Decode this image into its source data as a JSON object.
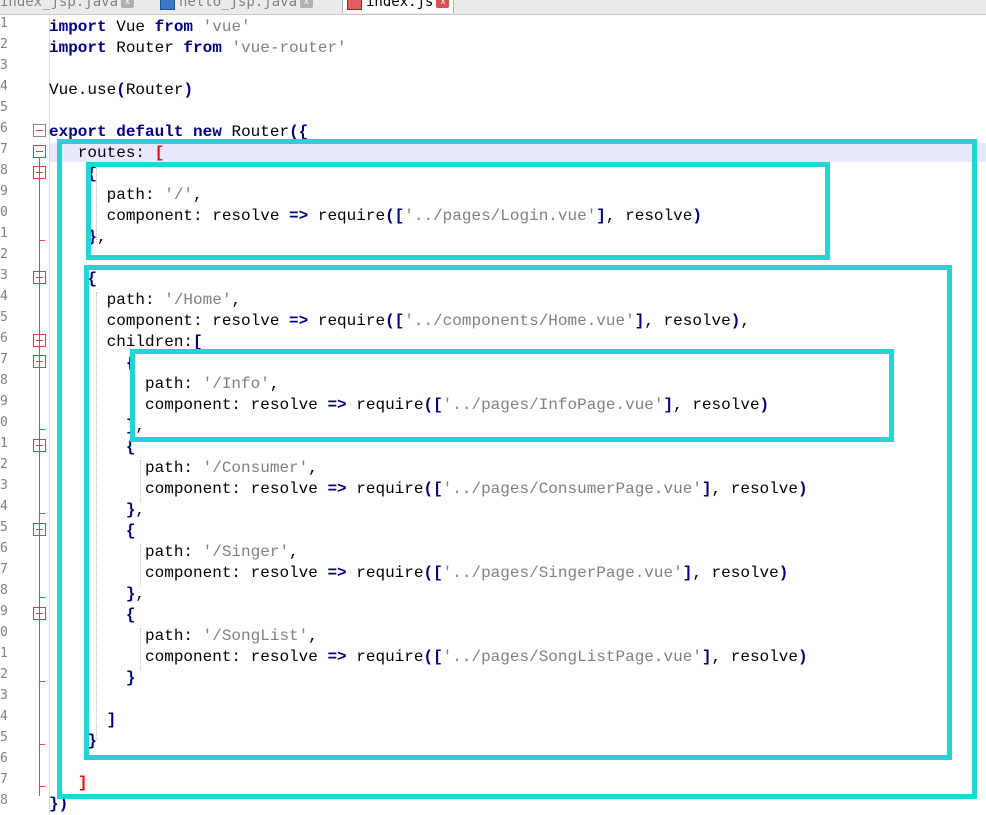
{
  "tabs": [
    {
      "label": "index_jsp.java",
      "active": false
    },
    {
      "label": "hello_jsp.java",
      "active": false
    },
    {
      "label": "index.js",
      "active": true
    }
  ],
  "line_numbers": [
    "1",
    "2",
    "3",
    "4",
    "5",
    "6",
    "7",
    "8",
    "9",
    "0",
    "1",
    "2",
    "3",
    "4",
    "5",
    "6",
    "7",
    "8",
    "9",
    "0",
    "1",
    "2",
    "3",
    "4",
    "5",
    "6",
    "7",
    "8",
    "9",
    "0",
    "1",
    "2",
    "3",
    "4",
    "5",
    "6",
    "7",
    "8"
  ],
  "code_lines": [
    [
      {
        "t": "import",
        "c": "kw"
      },
      {
        "t": " Vue "
      },
      {
        "t": "from",
        "c": "kw"
      },
      {
        "t": " "
      },
      {
        "t": "'vue'",
        "c": "str"
      }
    ],
    [
      {
        "t": "import",
        "c": "kw"
      },
      {
        "t": " Router "
      },
      {
        "t": "from",
        "c": "kw"
      },
      {
        "t": " "
      },
      {
        "t": "'vue-router'",
        "c": "str"
      }
    ],
    [],
    [
      {
        "t": "Vue.use"
      },
      {
        "t": "(",
        "c": "br"
      },
      {
        "t": "Router"
      },
      {
        "t": ")",
        "c": "br"
      }
    ],
    [],
    [
      {
        "t": "export",
        "c": "kw"
      },
      {
        "t": " "
      },
      {
        "t": "default",
        "c": "kw"
      },
      {
        "t": " "
      },
      {
        "t": "new",
        "c": "kw"
      },
      {
        "t": " Router"
      },
      {
        "t": "({",
        "c": "br"
      }
    ],
    [
      {
        "t": "   routes: "
      },
      {
        "t": "[",
        "c": "brr"
      }
    ],
    [
      {
        "t": "    "
      },
      {
        "t": "{",
        "c": "br"
      }
    ],
    [
      {
        "t": "      path: "
      },
      {
        "t": "'/'",
        "c": "str"
      },
      {
        "t": ","
      }
    ],
    [
      {
        "t": "      component: resolve "
      },
      {
        "t": "=>",
        "c": "br"
      },
      {
        "t": " require"
      },
      {
        "t": "([",
        "c": "br"
      },
      {
        "t": "'../pages/Login.vue'",
        "c": "str"
      },
      {
        "t": "]",
        "c": "br"
      },
      {
        "t": ", resolve"
      },
      {
        "t": ")",
        "c": "br"
      }
    ],
    [
      {
        "t": "    "
      },
      {
        "t": "}",
        "c": "br"
      },
      {
        "t": ","
      }
    ],
    [],
    [
      {
        "t": "    "
      },
      {
        "t": "{",
        "c": "br"
      }
    ],
    [
      {
        "t": "      path: "
      },
      {
        "t": "'/Home'",
        "c": "str"
      },
      {
        "t": ","
      }
    ],
    [
      {
        "t": "      component: resolve "
      },
      {
        "t": "=>",
        "c": "br"
      },
      {
        "t": " require"
      },
      {
        "t": "([",
        "c": "br"
      },
      {
        "t": "'../components/Home.vue'",
        "c": "str"
      },
      {
        "t": "]",
        "c": "br"
      },
      {
        "t": ", resolve"
      },
      {
        "t": ")",
        "c": "br"
      },
      {
        "t": ","
      }
    ],
    [
      {
        "t": "      children:"
      },
      {
        "t": "[",
        "c": "br"
      }
    ],
    [
      {
        "t": "        "
      },
      {
        "t": "{",
        "c": "br"
      }
    ],
    [
      {
        "t": "          path: "
      },
      {
        "t": "'/Info'",
        "c": "str"
      },
      {
        "t": ","
      }
    ],
    [
      {
        "t": "          component: resolve "
      },
      {
        "t": "=>",
        "c": "br"
      },
      {
        "t": " require"
      },
      {
        "t": "([",
        "c": "br"
      },
      {
        "t": "'../pages/InfoPage.vue'",
        "c": "str"
      },
      {
        "t": "]",
        "c": "br"
      },
      {
        "t": ", resolve"
      },
      {
        "t": ")",
        "c": "br"
      }
    ],
    [
      {
        "t": "        "
      },
      {
        "t": "}",
        "c": "br"
      },
      {
        "t": ","
      }
    ],
    [
      {
        "t": "        "
      },
      {
        "t": "{",
        "c": "br"
      }
    ],
    [
      {
        "t": "          path: "
      },
      {
        "t": "'/Consumer'",
        "c": "str"
      },
      {
        "t": ","
      }
    ],
    [
      {
        "t": "          component: resolve "
      },
      {
        "t": "=>",
        "c": "br"
      },
      {
        "t": " require"
      },
      {
        "t": "([",
        "c": "br"
      },
      {
        "t": "'../pages/ConsumerPage.vue'",
        "c": "str"
      },
      {
        "t": "]",
        "c": "br"
      },
      {
        "t": ", resolve"
      },
      {
        "t": ")",
        "c": "br"
      }
    ],
    [
      {
        "t": "        "
      },
      {
        "t": "}",
        "c": "br"
      },
      {
        "t": ","
      }
    ],
    [
      {
        "t": "        "
      },
      {
        "t": "{",
        "c": "br"
      }
    ],
    [
      {
        "t": "          path: "
      },
      {
        "t": "'/Singer'",
        "c": "str"
      },
      {
        "t": ","
      }
    ],
    [
      {
        "t": "          component: resolve "
      },
      {
        "t": "=>",
        "c": "br"
      },
      {
        "t": " require"
      },
      {
        "t": "([",
        "c": "br"
      },
      {
        "t": "'../pages/SingerPage.vue'",
        "c": "str"
      },
      {
        "t": "]",
        "c": "br"
      },
      {
        "t": ", resolve"
      },
      {
        "t": ")",
        "c": "br"
      }
    ],
    [
      {
        "t": "        "
      },
      {
        "t": "}",
        "c": "br"
      },
      {
        "t": ","
      }
    ],
    [
      {
        "t": "        "
      },
      {
        "t": "{",
        "c": "br"
      }
    ],
    [
      {
        "t": "          path: "
      },
      {
        "t": "'/SongList'",
        "c": "str"
      },
      {
        "t": ","
      }
    ],
    [
      {
        "t": "          component: resolve "
      },
      {
        "t": "=>",
        "c": "br"
      },
      {
        "t": " require"
      },
      {
        "t": "([",
        "c": "br"
      },
      {
        "t": "'../pages/SongListPage.vue'",
        "c": "str"
      },
      {
        "t": "]",
        "c": "br"
      },
      {
        "t": ", resolve"
      },
      {
        "t": ")",
        "c": "br"
      }
    ],
    [
      {
        "t": "        "
      },
      {
        "t": "}",
        "c": "br"
      }
    ],
    [],
    [
      {
        "t": "      "
      },
      {
        "t": "]",
        "c": "br"
      }
    ],
    [
      {
        "t": "    "
      },
      {
        "t": "}",
        "c": "br"
      }
    ],
    [],
    [
      {
        "t": "   "
      },
      {
        "t": "]",
        "c": "brr"
      }
    ],
    [
      {
        "t": "})",
        "c": "br"
      }
    ]
  ],
  "colors": {
    "highlight_box": "#1fd6d6",
    "keyword": "#00008b",
    "string": "#808080",
    "bracket": "#000080",
    "bracket_match": "#ff0000"
  }
}
